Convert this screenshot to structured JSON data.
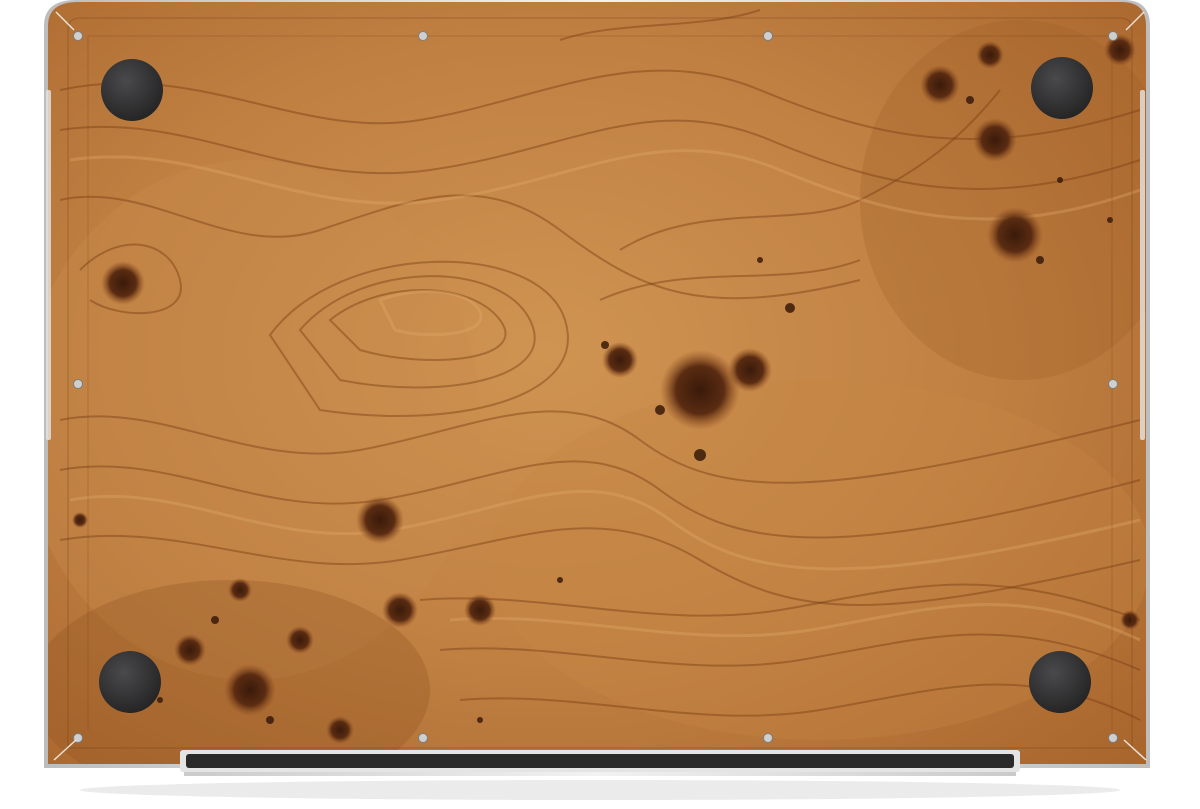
{
  "scene": {
    "subject": "laptop-bottom-case",
    "surface": "wood-burl-skin",
    "colors": {
      "background": "#ffffff",
      "wood_base": "#b9773c",
      "wood_light": "#d59a55",
      "wood_dark": "#8a4f1f",
      "grain_line": "#7a3f14",
      "burl_knot": "#4a2410",
      "rubber_feet": "#2e2e2f",
      "screws": "#c8c8c8",
      "hinge": "#2a2a2b",
      "aluminum_edge": "#d9d9da"
    },
    "components": {
      "rubber_feet_count": 4,
      "screw_count": 10,
      "hinge_bar_count": 1
    }
  }
}
